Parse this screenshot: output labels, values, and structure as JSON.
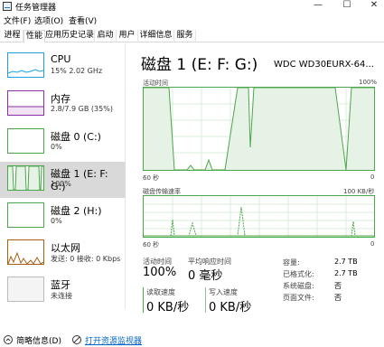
{
  "window": {
    "title": "任务管理器",
    "minimize": "—",
    "maximize": "☐",
    "close": "✕"
  },
  "menu": [
    "文件(F)",
    "选项(O)",
    "查看(V)"
  ],
  "tabs": [
    "进程",
    "性能",
    "应用历史记录",
    "启动",
    "用户",
    "详细信息",
    "服务"
  ],
  "active_tab": "性能",
  "sidebar": [
    {
      "name": "CPU",
      "sub": "15% 2.02 GHz",
      "color": "#1ba1e2"
    },
    {
      "name": "内存",
      "sub": "2.8/7.9 GB (35%)",
      "color": "#8b2ea8"
    },
    {
      "name": "磁盘 0 (C:)",
      "sub": "0%",
      "color": "#4ca64c"
    },
    {
      "name": "磁盘 1 (E: F: G:)",
      "sub": "100%",
      "color": "#4ca64c"
    },
    {
      "name": "磁盘 2 (H:)",
      "sub": "0%",
      "color": "#4ca64c"
    },
    {
      "name": "以太网",
      "sub": "发送: 0 接收: 0 Kbps",
      "color": "#a75d12"
    },
    {
      "name": "蓝牙",
      "sub": "未连接",
      "color": "#a75d12"
    }
  ],
  "main": {
    "title": "磁盘 1 (E: F: G:)",
    "model": "WDC WD30EURX-64...",
    "active_time_label": "活动时间",
    "active_time_max": "100%",
    "active_time_axis": "60 秒",
    "active_time_min": "0",
    "transfer_label": "磁盘传输速率",
    "transfer_max": "100 KB/秒",
    "transfer_axis": "60 秒",
    "transfer_min": "0"
  },
  "stats": {
    "active_label": "活动时间",
    "active_value": "100%",
    "response_label": "平均响应时间",
    "response_value": "0 毫秒",
    "read_label": "读取速度",
    "read_value": "0 KB/秒",
    "write_label": "写入速度",
    "write_value": "0 KB/秒"
  },
  "properties": [
    {
      "label": "容量:",
      "value": "2.7 TB"
    },
    {
      "label": "已格式化:",
      "value": "2.7 TB"
    },
    {
      "label": "系统磁盘:",
      "value": "否"
    },
    {
      "label": "页面文件:",
      "value": "否"
    }
  ],
  "footer": {
    "summary": "简略信息(D)",
    "resmon": "打开资源监视器"
  }
}
